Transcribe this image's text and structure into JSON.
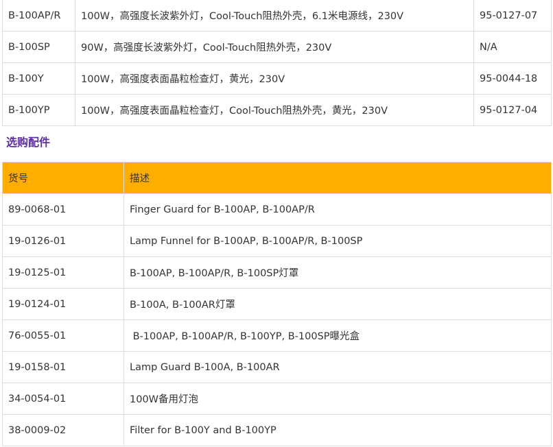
{
  "product_table": {
    "rows": [
      {
        "model": "B-100AP/R",
        "description": "100W，高强度长波紫外灯，Cool-Touch阻热外壳，6.1米电源线，230V",
        "part_no": "95-0127-07"
      },
      {
        "model": "B-100SP",
        "description": "90W，高强度长波紫外灯，Cool-Touch阻热外壳，230V",
        "part_no": "N/A"
      },
      {
        "model": "B-100Y",
        "description": "100W，高强度表面晶粒检查灯，黄光，230V",
        "part_no": "95-0044-18"
      },
      {
        "model": "B-100YP",
        "description": "100W，高强度表面晶粒检查灯，Cool-Touch阻热外壳，黄光，230V",
        "part_no": "95-0127-04"
      }
    ]
  },
  "accessories": {
    "title": "选购配件",
    "colors": {
      "header_bg": "#ffae00",
      "title": "#5b2d9e"
    },
    "headers": {
      "part_no": "货号",
      "description": "描述"
    },
    "rows": [
      {
        "part_no": "89-0068-01",
        "description": "Finger Guard for B-100AP, B-100AP/R"
      },
      {
        "part_no": "19-0126-01",
        "description": "Lamp Funnel for B-100AP, B-100AP/R, B-100SP"
      },
      {
        "part_no": "19-0125-01",
        "description": "B-100AP, B-100AP/R, B-100SP灯罩"
      },
      {
        "part_no": "19-0124-01",
        "description": "B-100A, B-100AR灯罩"
      },
      {
        "part_no": "76-0055-01",
        "description": " B-100AP, B-100AP/R, B-100YP, B-100SP曝光盒"
      },
      {
        "part_no": "19-0158-01",
        "description": "Lamp Guard B-100A, B-100AR"
      },
      {
        "part_no": "34-0054-01",
        "description": "100W备用灯泡"
      },
      {
        "part_no": "38-0009-02",
        "description": "Filter for B-100Y and B-100YP"
      }
    ]
  }
}
